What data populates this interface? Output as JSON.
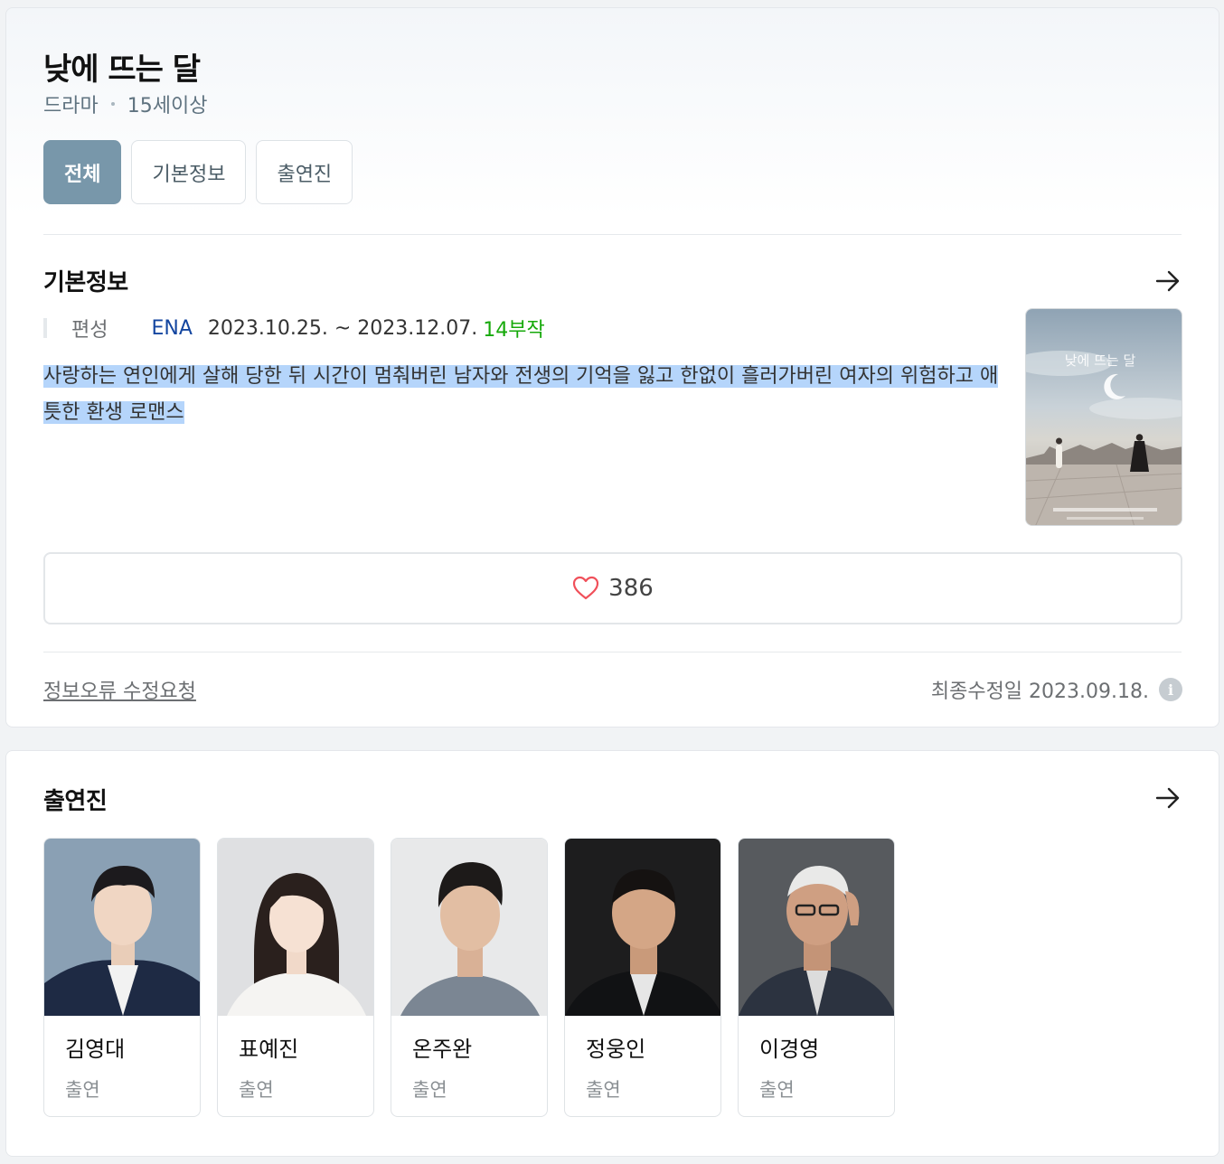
{
  "header": {
    "title": "낮에 뜨는 달",
    "genre": "드라마",
    "rating": "15세이상"
  },
  "tabs": [
    {
      "label": "전체",
      "active": true
    },
    {
      "label": "기본정보",
      "active": false
    },
    {
      "label": "출연진",
      "active": false
    }
  ],
  "basic_info": {
    "heading": "기본정보",
    "label": "편성",
    "broadcaster": "ENA",
    "dates": "2023.10.25. ~ 2023.12.07.",
    "episodes": "14부작",
    "synopsis": "사랑하는 연인에게 살해 당한 뒤 시간이 멈춰버린 남자와 전생의 기억을 잃고 한없이 흘러가버린 여자의 위험하고 애틋한 환생 로맨스",
    "poster_text": "낮에 뜨는 달"
  },
  "like": {
    "icon": "heart-icon",
    "count": "386"
  },
  "footer": {
    "report": "정보오류 수정요청",
    "updated": "최종수정일 2023.09.18.",
    "info_icon": "i"
  },
  "cast": {
    "heading": "출연진",
    "members": [
      {
        "name": "김영대",
        "role": "출연"
      },
      {
        "name": "표예진",
        "role": "출연"
      },
      {
        "name": "온주완",
        "role": "출연"
      },
      {
        "name": "정웅인",
        "role": "출연"
      },
      {
        "name": "이경영",
        "role": "출연"
      }
    ]
  },
  "colors": {
    "accent_tab": "#7897aa",
    "broadcaster_link": "#1446a0",
    "episodes_green": "#16a90a",
    "heart_red": "#f0505a",
    "selection": "#b5d5fb"
  }
}
